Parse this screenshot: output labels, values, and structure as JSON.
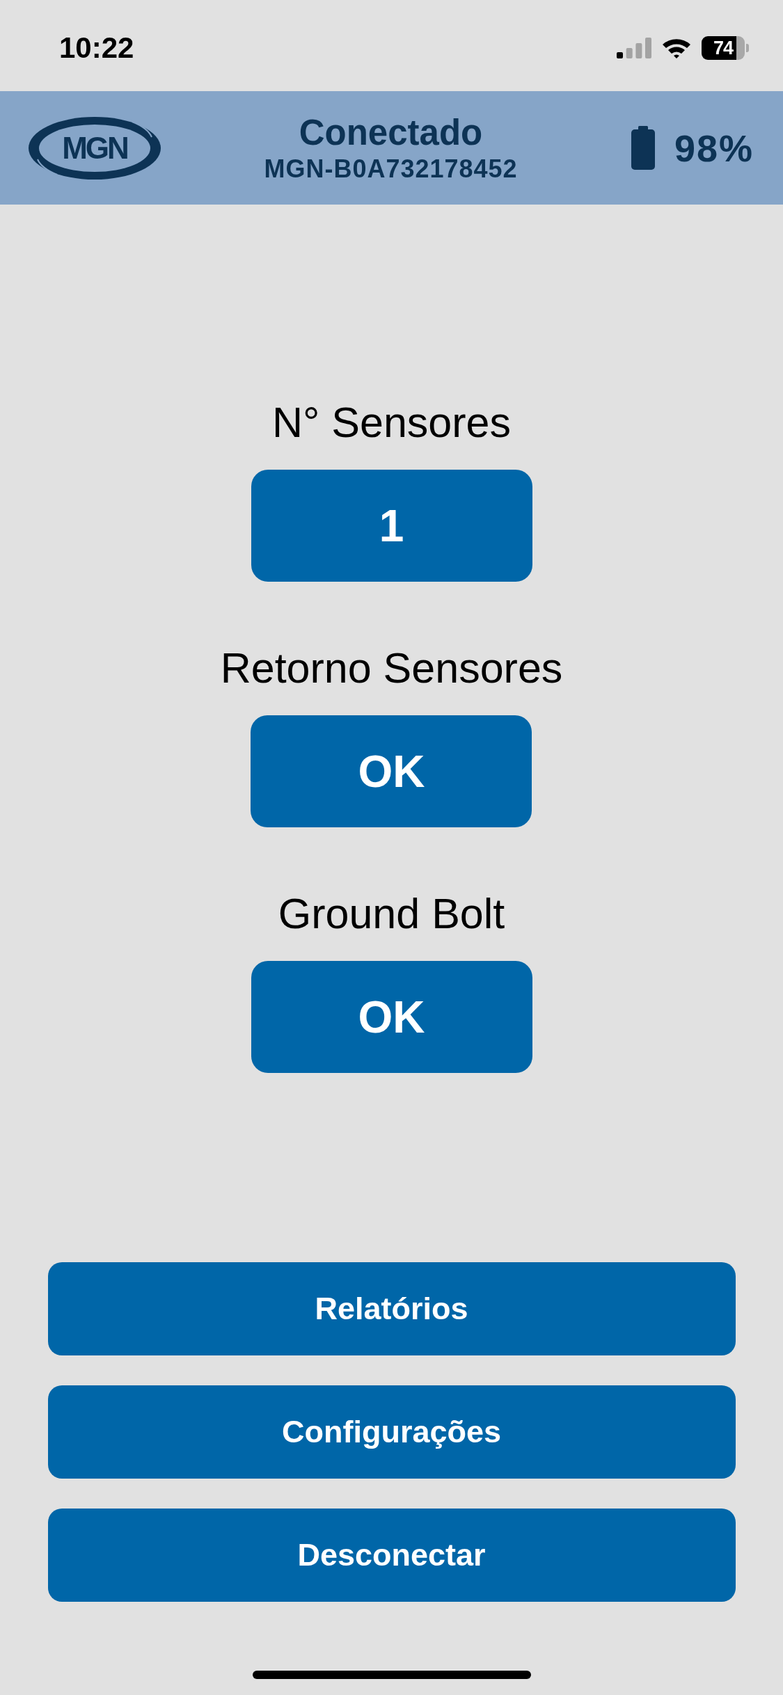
{
  "status_bar": {
    "time": "10:22",
    "battery": "74"
  },
  "header": {
    "logo": "MGN",
    "title": "Conectado",
    "device_id": "MGN-B0A732178452",
    "battery": "98%"
  },
  "readings": [
    {
      "label": "N° Sensores",
      "value": "1"
    },
    {
      "label": "Retorno Sensores",
      "value": "OK"
    },
    {
      "label": "Ground Bolt",
      "value": "OK"
    }
  ],
  "actions": [
    {
      "label": "Relatórios"
    },
    {
      "label": "Configurações"
    },
    {
      "label": "Desconectar"
    }
  ]
}
